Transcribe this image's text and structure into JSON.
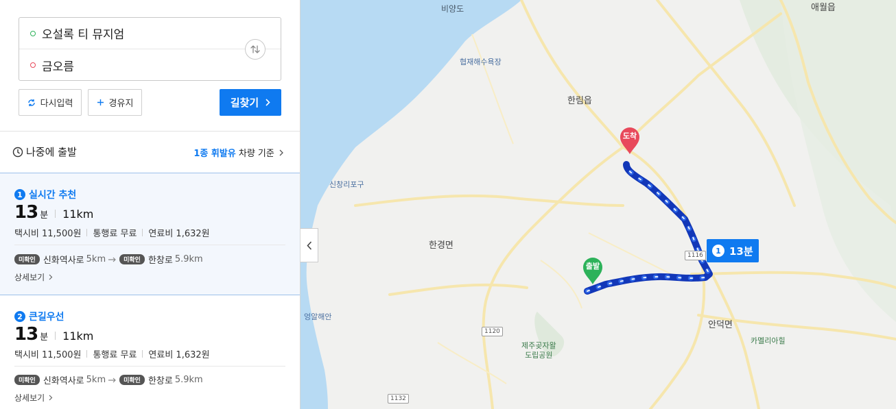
{
  "search": {
    "origin": "오설록 티 뮤지엄",
    "destination": "금오름",
    "reset_label": "다시입력",
    "via_label": "경유지",
    "find_label": "길찾기"
  },
  "options": {
    "depart_later": "나중에 출발",
    "fuel_type": "1종 휘발유",
    "fuel_basis": " 차량 기준"
  },
  "routes": [
    {
      "num": "1",
      "title": "실시간 추천",
      "minutes": "13",
      "min_unit": "분",
      "distance": "11km",
      "taxi": "택시비 11,500원",
      "toll": "통행료 무료",
      "fuel": "연료비 1,632원",
      "badge": "미확인",
      "road1": "신화역사로",
      "road1_km": "5km",
      "road2": "한창로",
      "road2_km": "5.9km",
      "detail": "상세보기"
    },
    {
      "num": "2",
      "title": "큰길우선",
      "minutes": "13",
      "min_unit": "분",
      "distance": "11km",
      "taxi": "택시비 11,500원",
      "toll": "통행료 무료",
      "fuel": "연료비 1,632원",
      "badge": "미확인",
      "road1": "신화역사로",
      "road1_km": "5km",
      "road2": "한창로",
      "road2_km": "5.9km",
      "detail": "상세보기"
    }
  ],
  "map": {
    "labels": {
      "biyangdo": "비양도",
      "aewol": "애월읍",
      "hyeopjae": "협재해수욕장",
      "hallim": "한림읍",
      "sinchang": "신창리포구",
      "hangyeong": "한경면",
      "eongal": "엉알해안",
      "andeok": "안덕면",
      "camellia": "카멜리아힐",
      "gotjawal": "제주곶자왈\n도립공원"
    },
    "roads": {
      "r1116": "1116",
      "r1120": "1120",
      "r1132": "1132"
    },
    "start_marker": "출발",
    "end_marker": "도착",
    "eta_num": "1",
    "eta_text": "13분"
  },
  "colors": {
    "accent": "#0f7af0",
    "route": "#1a52d6",
    "start": "#2db25a",
    "end": "#e8495b",
    "sea": "#b7daf3",
    "land": "#f1f1ef"
  },
  "icons": [
    "refresh-icon",
    "plus-icon",
    "chevron-right-icon",
    "clock-icon",
    "swap-icon",
    "chevron-left-icon"
  ]
}
